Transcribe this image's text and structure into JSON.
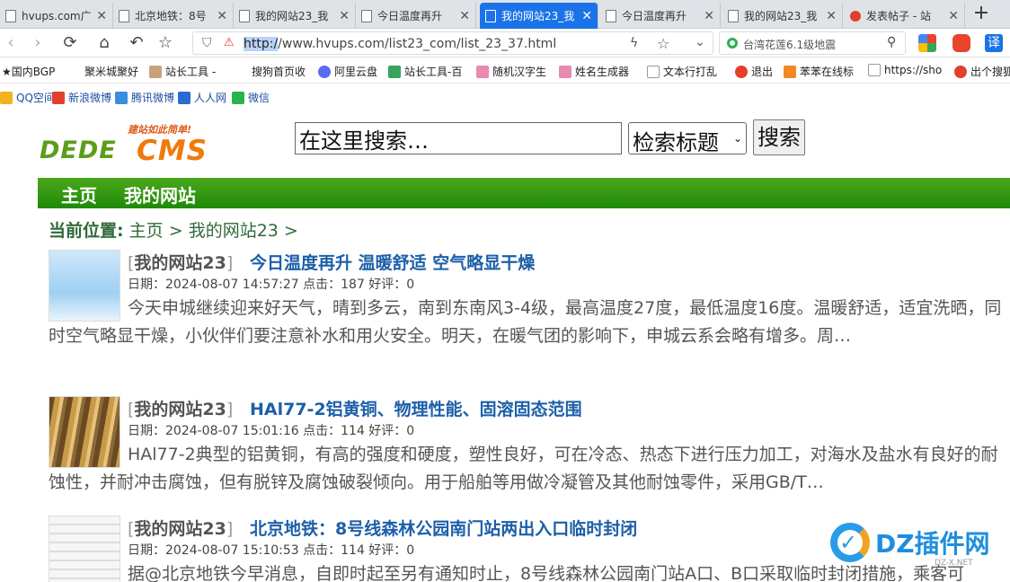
{
  "browser": {
    "tabs": [
      {
        "label": "hvups.com广",
        "active": false
      },
      {
        "label": "北京地铁：8号",
        "active": false
      },
      {
        "label": "我的网站23_我",
        "active": false
      },
      {
        "label": "今日温度再升",
        "active": false
      },
      {
        "label": "我的网站23_我",
        "active": true
      },
      {
        "label": "今日温度再升",
        "active": false
      },
      {
        "label": "我的网站23_我",
        "active": false
      },
      {
        "label": "发表帖子 - 站",
        "active": false
      }
    ],
    "new_tab_label": "+",
    "url_scheme": "http:/",
    "url_rest": "/www.hvups.com/list23_com/list_23_37.html",
    "side_search_text": "台湾花莲6.1级地震",
    "translate_label": "译",
    "bookmarks_row1": [
      "★国内BGP",
      "聚米城聚好",
      "站长工具 -",
      "搜狗首页收",
      "阿里云盘",
      "站长工具-百",
      "随机汉字生",
      "姓名生成器",
      "文本行打乱",
      "退出",
      "苯苯在线标",
      "https://sho",
      "出个搜狐"
    ],
    "bookmarks_row2": [
      "QQ空间",
      "新浪微博",
      "腾讯微博",
      "人人网",
      "微信"
    ]
  },
  "site": {
    "logo_main": "DEDECMS",
    "logo_slogan": "建站如此简单!",
    "search_placeholder": "在这里搜索…",
    "search_select_value": "检索标题",
    "search_button": "搜索",
    "nav": [
      "主页",
      "我的网站"
    ],
    "breadcrumb_lead": "当前位置:",
    "breadcrumb": [
      "主页",
      ">",
      "我的网站23",
      ">"
    ]
  },
  "articles": [
    {
      "category": "我的网站23",
      "title": "今日温度再升 温暖舒适 空气略显干燥",
      "meta": "日期：2024-08-07 14:57:27 点击：187 好评：0",
      "desc": "今天申城继续迎来好天气，晴到多云，南到东南风3-4级，最高温度27度，最低温度16度。温暖舒适，适宜洗晒，同时空气略显干燥，小伙伴们要注意补水和用火安全。明天，在暖气团的影响下，申城云系会略有增多。周…"
    },
    {
      "category": "我的网站23",
      "title": "HAl77-2铝黄铜、物理性能、固溶固态范围",
      "meta": "日期：2024-08-07 15:01:16 点击：114 好评：0",
      "desc": "HAl77-2典型的铝黄铜，有高的强度和硬度，塑性良好，可在冷态、热态下进行压力加工，对海水及盐水有良好的耐蚀性，并耐冲击腐蚀，但有脱锌及腐蚀破裂倾向。用于船舶等用做冷凝管及其他耐蚀零件，采用GB/T…"
    },
    {
      "category": "我的网站23",
      "title": "北京地铁：8号线森林公园南门站两出入口临时封闭",
      "meta": "日期：2024-08-07 15:10:53 点击：114 好评：0",
      "desc": "据@北京地铁今早消息，自即时起至另有通知时止，8号线森林公园南门站A口、B口采取临时封闭措施，乘客可"
    }
  ],
  "watermark": {
    "text": "DZ插件网",
    "sub": "DZ-X.NET"
  },
  "colors": {
    "nav_green": "#2a8f10",
    "link_blue": "#1c5fa8",
    "tab_active": "#1a73e8"
  }
}
